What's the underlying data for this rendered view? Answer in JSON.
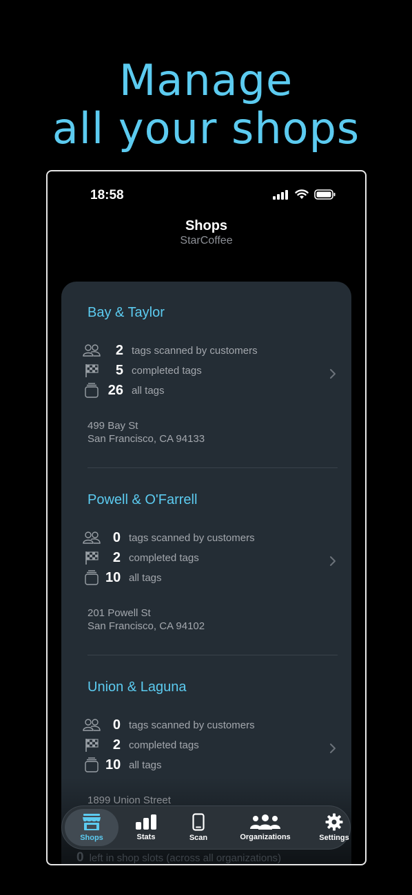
{
  "headline": {
    "line1": "Manage",
    "line2": "all your shops"
  },
  "status_bar": {
    "time": "18:58"
  },
  "header": {
    "title": "Shops",
    "subtitle": "StarCoffee"
  },
  "shops": [
    {
      "name": "Bay & Taylor",
      "stats": [
        {
          "icon": "people-icon",
          "value": "2",
          "label": "tags scanned by customers"
        },
        {
          "icon": "checkered-flag-icon",
          "value": "5",
          "label": "completed tags"
        },
        {
          "icon": "tag-stack-icon",
          "value": "26",
          "label": "all tags"
        }
      ],
      "address_line1": "499 Bay St",
      "address_line2": "San Francisco, CA 94133"
    },
    {
      "name": "Powell & O'Farrell",
      "stats": [
        {
          "icon": "people-icon",
          "value": "0",
          "label": "tags scanned by customers"
        },
        {
          "icon": "checkered-flag-icon",
          "value": "2",
          "label": "completed tags"
        },
        {
          "icon": "tag-stack-icon",
          "value": "10",
          "label": "all tags"
        }
      ],
      "address_line1": "201 Powell St",
      "address_line2": "San Francisco, CA 94102"
    },
    {
      "name": "Union & Laguna",
      "stats": [
        {
          "icon": "people-icon",
          "value": "0",
          "label": "tags scanned by customers"
        },
        {
          "icon": "checkered-flag-icon",
          "value": "2",
          "label": "completed tags"
        },
        {
          "icon": "tag-stack-icon",
          "value": "10",
          "label": "all tags"
        }
      ],
      "address_line1": "1899 Union Street",
      "address_line2": ""
    }
  ],
  "tabbar": {
    "tabs": [
      {
        "label": "Shops",
        "icon": "storefront-icon",
        "active": true
      },
      {
        "label": "Stats",
        "icon": "bar-chart-icon",
        "active": false
      },
      {
        "label": "Scan",
        "icon": "phone-icon",
        "active": false
      },
      {
        "label": "Organizations",
        "icon": "people-group-icon",
        "active": false
      },
      {
        "label": "Settings",
        "icon": "gear-icon",
        "active": false
      }
    ]
  },
  "footer": {
    "count": "0",
    "text": "left in shop slots (across all organizations)"
  },
  "colors": {
    "accent": "#5ccbf0",
    "card": "#242d35",
    "tabbar": "#2b3238"
  }
}
